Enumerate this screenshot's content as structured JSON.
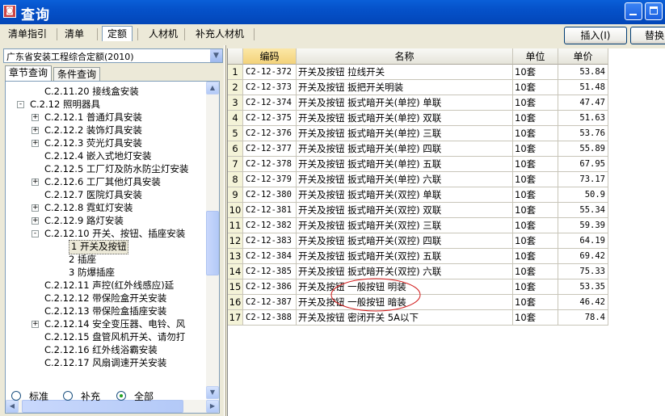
{
  "window": {
    "title": "查询"
  },
  "tabs": [
    "清单指引",
    "清单",
    "定额",
    "人材机",
    "补充人材机"
  ],
  "active_tab": "定额",
  "buttons": {
    "insert": "插入(I)",
    "replace": "替换"
  },
  "left": {
    "combo_value": "广东省安装工程综合定额(2010)",
    "subtabs": [
      "章节查询",
      "条件查询"
    ],
    "tree": [
      {
        "label": "C.2.11.20 接线盒安装",
        "level": 3,
        "expander": ""
      },
      {
        "label": "C.2.12 照明器具",
        "level": 2,
        "expander": "-"
      },
      {
        "label": "C.2.12.1 普通灯具安装",
        "level": 3,
        "expander": "+"
      },
      {
        "label": "C.2.12.2 装饰灯具安装",
        "level": 3,
        "expander": "+"
      },
      {
        "label": "C.2.12.3 荧光灯具安装",
        "level": 3,
        "expander": "+"
      },
      {
        "label": "C.2.12.4 嵌入式地灯安装",
        "level": 3,
        "expander": ""
      },
      {
        "label": "C.2.12.5 工厂灯及防水防尘灯安装",
        "level": 3,
        "expander": ""
      },
      {
        "label": "C.2.12.6 工厂其他灯具安装",
        "level": 3,
        "expander": "+"
      },
      {
        "label": "C.2.12.7 医院灯具安装",
        "level": 3,
        "expander": ""
      },
      {
        "label": "C.2.12.8 霓虹灯安装",
        "level": 3,
        "expander": "+"
      },
      {
        "label": "C.2.12.9 路灯安装",
        "level": 3,
        "expander": "+"
      },
      {
        "label": "C.2.12.10 开关、按钮、插座安装",
        "level": 3,
        "expander": "-"
      },
      {
        "label": "1 开关及按钮",
        "level": 4,
        "expander": "",
        "selected": true
      },
      {
        "label": "2 插座",
        "level": 4,
        "expander": ""
      },
      {
        "label": "3 防爆插座",
        "level": 4,
        "expander": ""
      },
      {
        "label": "C.2.12.11 声控(红外线感应)延",
        "level": 3,
        "expander": ""
      },
      {
        "label": "C.2.12.12 带保险盒开关安装",
        "level": 3,
        "expander": ""
      },
      {
        "label": "C.2.12.13 带保险盒插座安装",
        "level": 3,
        "expander": ""
      },
      {
        "label": "C.2.12.14 安全变压器、电铃、风",
        "level": 3,
        "expander": "+"
      },
      {
        "label": "C.2.12.15 盘管风机开关、请勿打",
        "level": 3,
        "expander": ""
      },
      {
        "label": "C.2.12.16 红外线浴霸安装",
        "level": 3,
        "expander": ""
      },
      {
        "label": "C.2.12.17 风扇调速开关安装",
        "level": 3,
        "expander": ""
      }
    ],
    "radios": [
      {
        "label": "标准",
        "checked": false
      },
      {
        "label": "补充",
        "checked": false
      },
      {
        "label": "全部",
        "checked": true
      }
    ]
  },
  "table": {
    "headers": [
      "",
      "编码",
      "名称",
      "单位",
      "单价"
    ],
    "rows": [
      [
        "1",
        "C2-12-372",
        "开关及按钮 拉线开关",
        "10套",
        "53.84"
      ],
      [
        "2",
        "C2-12-373",
        "开关及按钮 扳把开关明装",
        "10套",
        "51.48"
      ],
      [
        "3",
        "C2-12-374",
        "开关及按钮 扳式暗开关(单控) 单联",
        "10套",
        "47.47"
      ],
      [
        "4",
        "C2-12-375",
        "开关及按钮 扳式暗开关(单控) 双联",
        "10套",
        "51.63"
      ],
      [
        "5",
        "C2-12-376",
        "开关及按钮 扳式暗开关(单控) 三联",
        "10套",
        "53.76"
      ],
      [
        "6",
        "C2-12-377",
        "开关及按钮 扳式暗开关(单控) 四联",
        "10套",
        "55.89"
      ],
      [
        "7",
        "C2-12-378",
        "开关及按钮 扳式暗开关(单控) 五联",
        "10套",
        "67.95"
      ],
      [
        "8",
        "C2-12-379",
        "开关及按钮 扳式暗开关(单控) 六联",
        "10套",
        "73.17"
      ],
      [
        "9",
        "C2-12-380",
        "开关及按钮 扳式暗开关(双控) 单联",
        "10套",
        "50.9"
      ],
      [
        "10",
        "C2-12-381",
        "开关及按钮 扳式暗开关(双控) 双联",
        "10套",
        "55.34"
      ],
      [
        "11",
        "C2-12-382",
        "开关及按钮 扳式暗开关(双控) 三联",
        "10套",
        "59.39"
      ],
      [
        "12",
        "C2-12-383",
        "开关及按钮 扳式暗开关(双控) 四联",
        "10套",
        "64.19"
      ],
      [
        "13",
        "C2-12-384",
        "开关及按钮 扳式暗开关(双控) 五联",
        "10套",
        "69.42"
      ],
      [
        "14",
        "C2-12-385",
        "开关及按钮 扳式暗开关(双控) 六联",
        "10套",
        "75.33"
      ],
      [
        "15",
        "C2-12-386",
        "开关及按钮 一般按钮 明装",
        "10套",
        "53.35"
      ],
      [
        "16",
        "C2-12-387",
        "开关及按钮 一般按钮 暗装",
        "10套",
        "46.42"
      ],
      [
        "17",
        "C2-12-388",
        "开关及按钮 密闭开关 5A以下",
        "10套",
        "78.4"
      ]
    ]
  },
  "colors": {
    "titlebar": "#0551c9",
    "row_number_bg": "#f4f3d8",
    "annotation": "#d22020"
  }
}
